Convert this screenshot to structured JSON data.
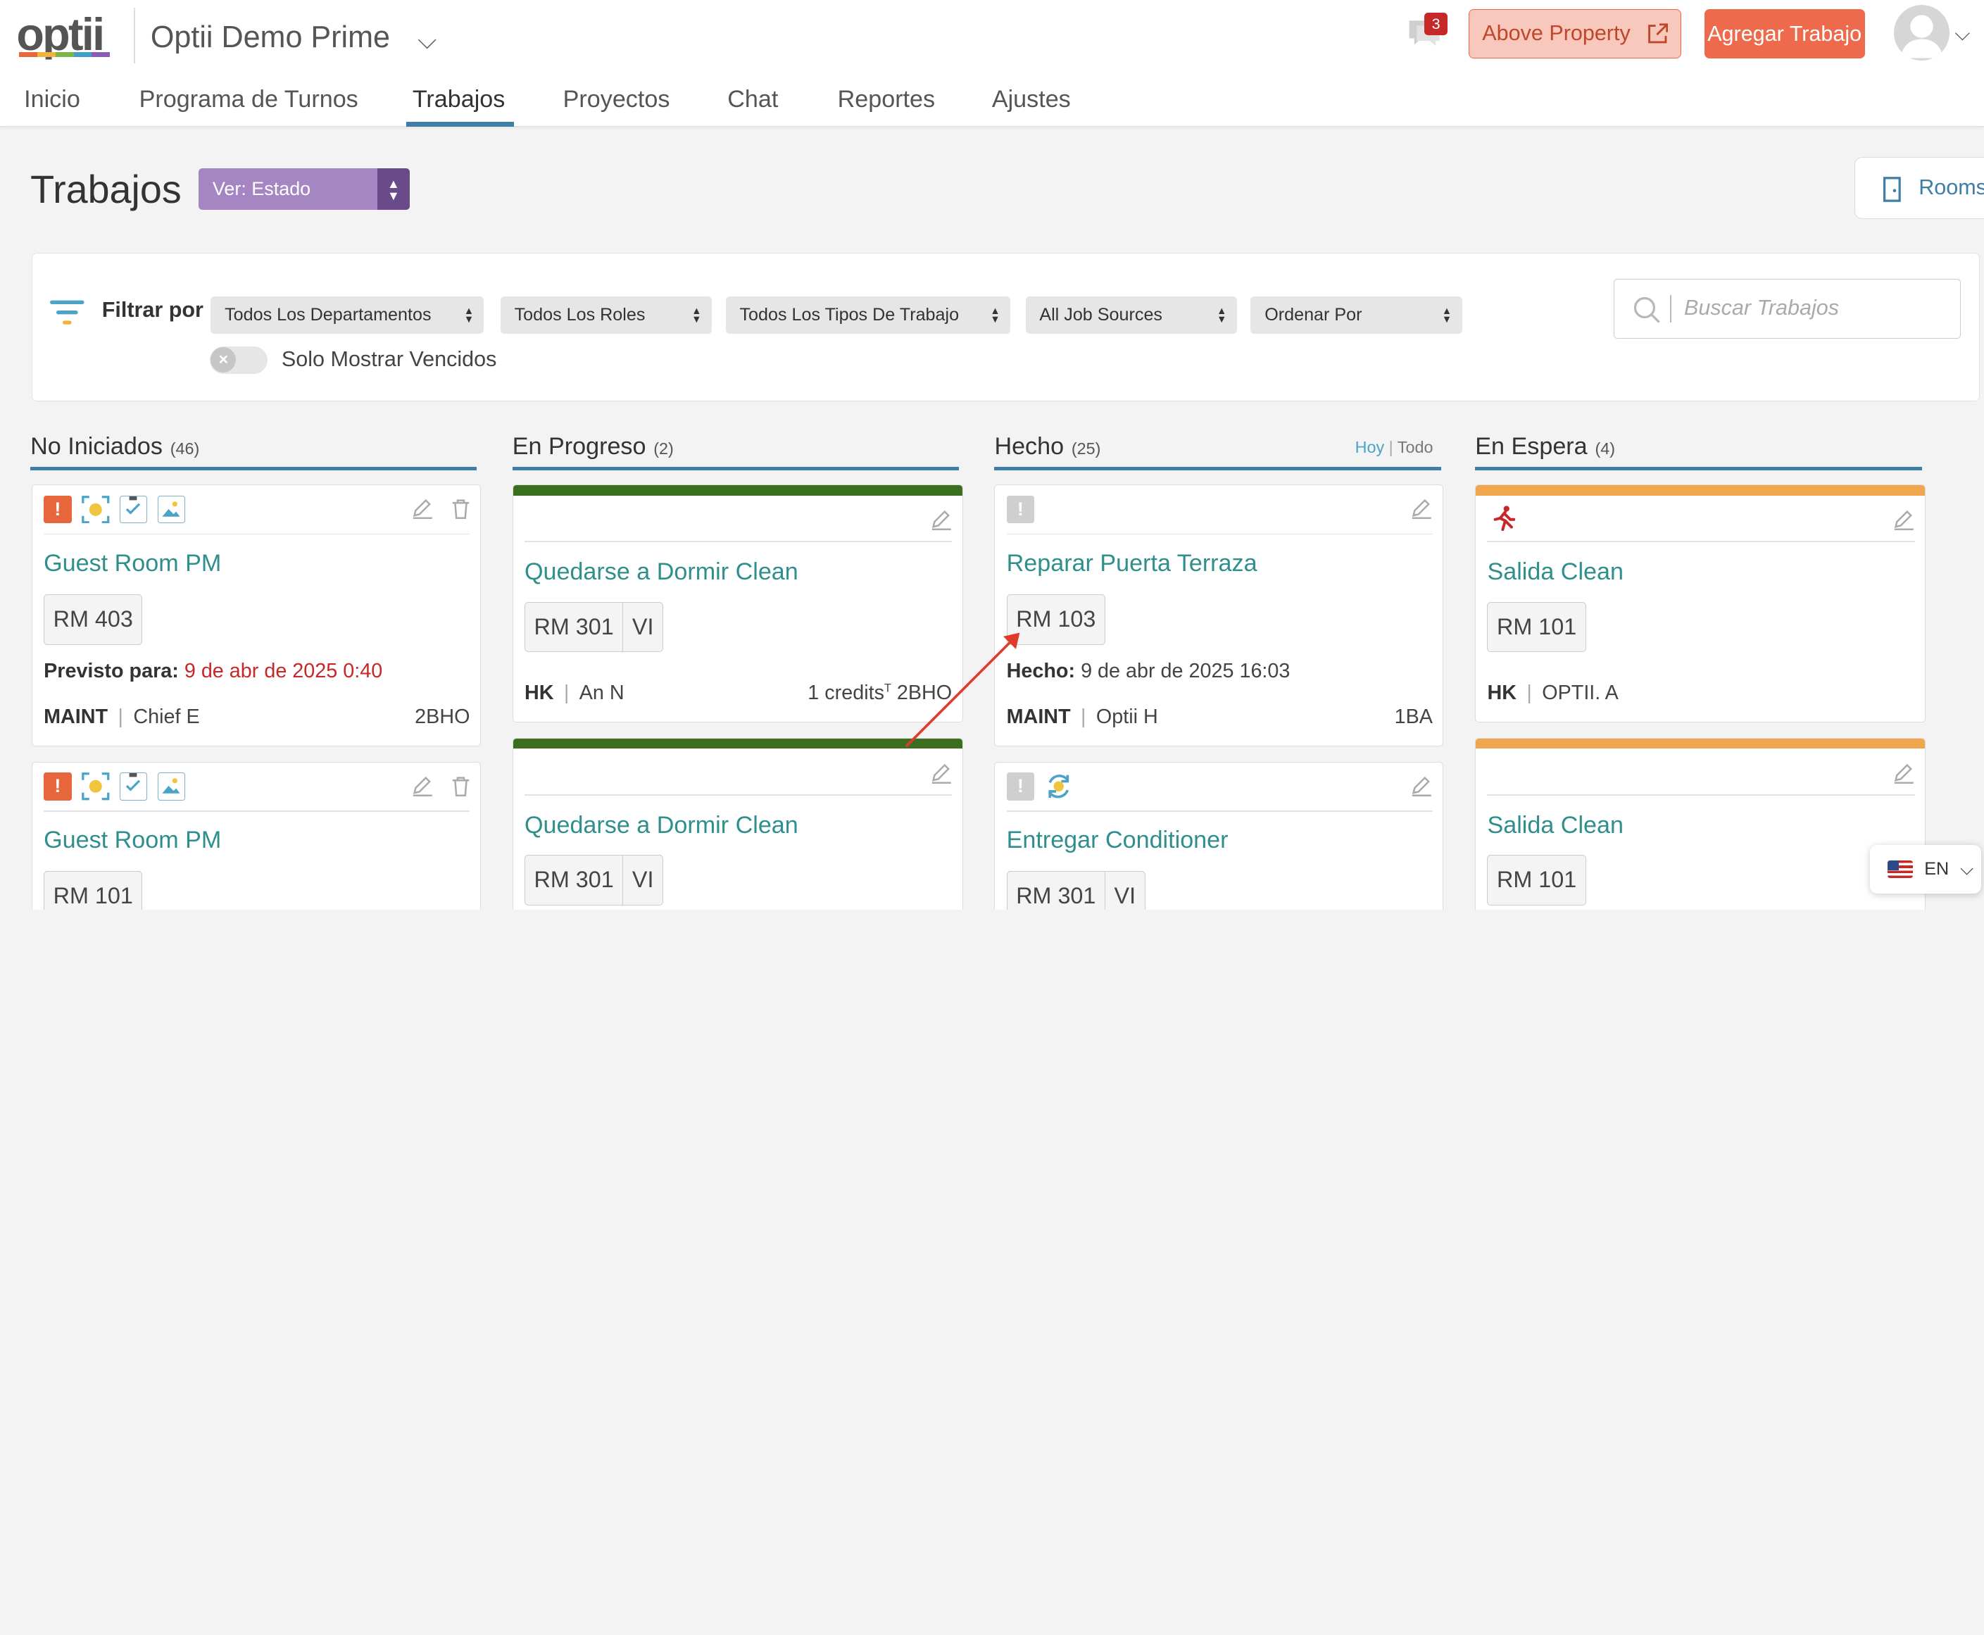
{
  "app": {
    "logo": "optii",
    "property": "Optii Demo Prime",
    "chat_count": "3",
    "above_property": "Above Property",
    "add_job": "Agregar Trabajo"
  },
  "colors": {
    "accent": "#3f7ea6",
    "brand_orange": "#ee6a4c",
    "title_teal": "#2f8f8c",
    "green": "#3b6e1f",
    "amber": "#f0a64c",
    "purple": "#a586c2"
  },
  "tabs": [
    "Inicio",
    "Programa de Turnos",
    "Trabajos",
    "Proyectos",
    "Chat",
    "Reportes",
    "Ajustes"
  ],
  "active_tab": "Trabajos",
  "page": {
    "title": "Trabajos",
    "view_select": "Ver: Estado",
    "rooms_button": "Rooms"
  },
  "filters": {
    "label": "Filtrar por",
    "departments": "Todos Los Departamentos",
    "roles": "Todos Los Roles",
    "job_types": "Todos Los Tipos De Trabajo",
    "sources": "All Job Sources",
    "sort": "Ordenar Por",
    "overdue_toggle": "Solo Mostrar Vencidos",
    "search_placeholder": "Buscar Trabajos"
  },
  "columns": {
    "not_started": {
      "title": "No Iniciados",
      "count": "(46)"
    },
    "in_progress": {
      "title": "En Progreso",
      "count": "(2)"
    },
    "done": {
      "title": "Hecho",
      "count": "(25)",
      "today": "Hoy",
      "all": "Todo"
    },
    "on_hold": {
      "title": "En Espera",
      "count": "(4)"
    }
  },
  "cards": {
    "ns1": {
      "title": "Guest Room PM",
      "room": "RM 403",
      "due_label": "Previsto para:",
      "due_value": "9 de abr de 2025 0:40",
      "dept": "MAINT",
      "assignee": "Chief E",
      "location": "2BHO",
      "icons": [
        "priority-icon",
        "room-check-icon",
        "checklist-icon",
        "image-icon"
      ]
    },
    "ns2": {
      "title": "Guest Room PM",
      "room": "RM 101"
    },
    "ip1": {
      "title": "Quedarse a Dormir Clean",
      "room": "RM 301",
      "tag": "VI",
      "dept": "HK",
      "assignee": "An N",
      "credits": "1 credits",
      "credits_sup": "T",
      "location": "2BHO"
    },
    "ip2": {
      "title": "Quedarse a Dormir Clean",
      "room": "RM 301",
      "tag": "VI"
    },
    "d1": {
      "title": "Reparar Puerta Terraza",
      "room": "RM 103",
      "done_label": "Hecho:",
      "done_value": "9 de abr de 2025 16:03",
      "dept": "MAINT",
      "assignee": "Optii H",
      "location": "1BA"
    },
    "d2": {
      "title": "Entregar Conditioner",
      "room": "RM 301",
      "tag": "VI"
    },
    "h1": {
      "title": "Salida Clean",
      "room": "RM 101",
      "dept": "HK",
      "assignee": "OPTII. A"
    },
    "h2": {
      "title": "Salida Clean",
      "room": "RM 101"
    }
  },
  "language": "EN"
}
